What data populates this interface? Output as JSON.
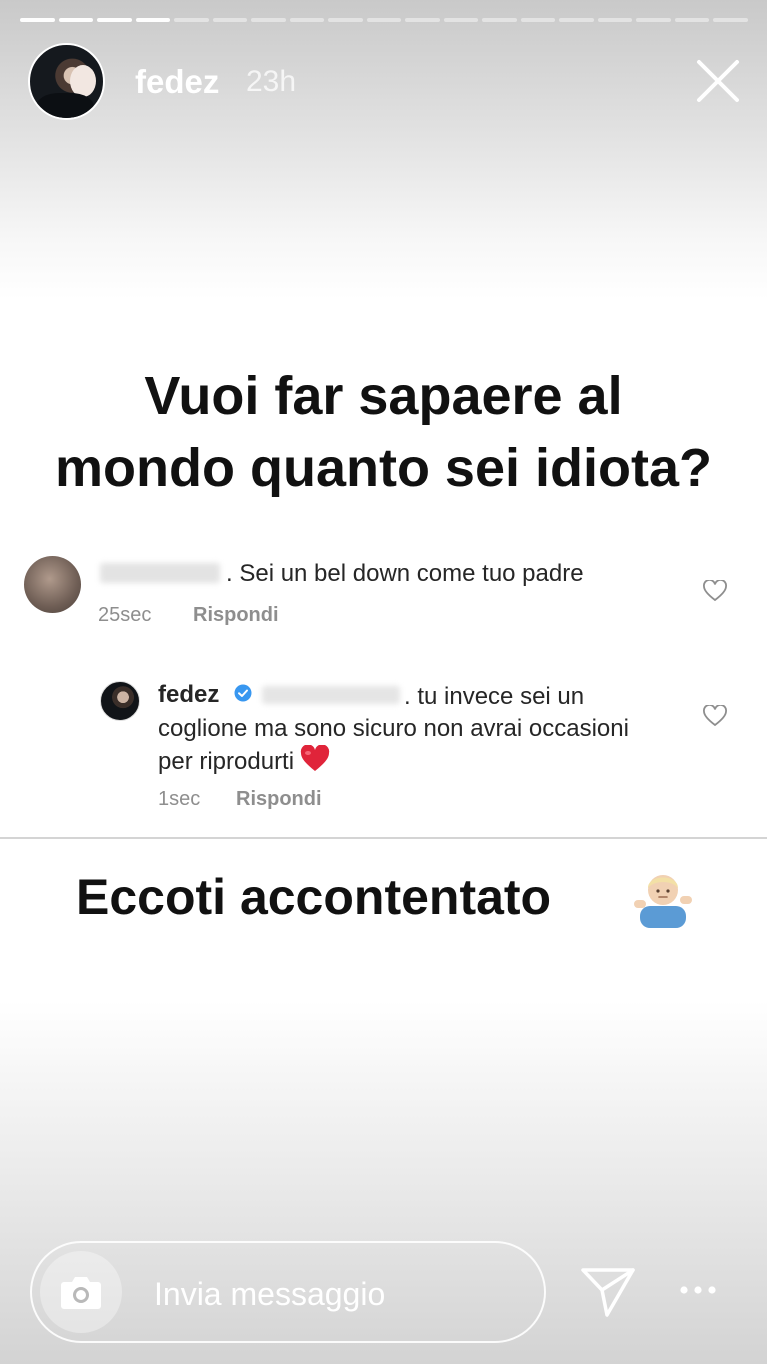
{
  "story": {
    "progress_segments_total": 19,
    "progress_segments_viewed": 4,
    "author": "fedez",
    "age": "23h",
    "title_lines": [
      "Vuoi far sapaere al",
      "mondo quanto sei idiota?"
    ],
    "comments": [
      {
        "text": ". Sei un bel down come tuo padre",
        "time": "25sec",
        "reply_label": "Rispondi"
      },
      {
        "username": "fedez",
        "verified": true,
        "text": ". tu invece sei un coglione ma sono sicuro non avrai occasioni per riprodurti",
        "time": "1sec",
        "reply_label": "Rispondi"
      }
    ],
    "subtitle": "Eccoti accontentato"
  },
  "footer": {
    "message_placeholder": "Invia messaggio"
  },
  "icons": {
    "close": "close-icon",
    "camera": "camera-icon",
    "send": "send-icon",
    "more": "more-icon",
    "like": "heart-outline-icon",
    "verified": "verified-badge-icon",
    "emoji_heart": "red-heart-emoji",
    "emoji_shrug": "shrug-emoji"
  },
  "colors": {
    "verified_blue": "#3897f0",
    "heart_red": "#e0243a",
    "text_dark": "#262626",
    "meta_gray": "#8e8e8e"
  }
}
